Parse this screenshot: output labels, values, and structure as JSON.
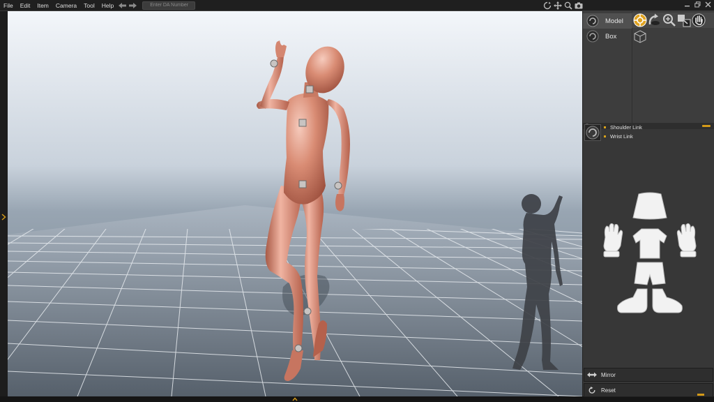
{
  "menu": {
    "items": [
      "File",
      "Edit",
      "Item",
      "Camera",
      "Tool",
      "Help"
    ],
    "da_placeholder": "Enter DA Number",
    "tool_icons": [
      "rotate-icon",
      "move-icon",
      "zoom-icon",
      "camera-icon"
    ],
    "window_controls": [
      "minimize-icon",
      "restore-icon",
      "close-icon"
    ]
  },
  "scene": {
    "items": [
      {
        "label": "Model",
        "selected": true
      },
      {
        "label": "Box",
        "selected": false
      }
    ],
    "tools": [
      "pose-tool-icon",
      "rotate-tool-icon",
      "zoom-tool-icon",
      "scale-tool-icon",
      "hand-tool-icon"
    ]
  },
  "links": {
    "items": [
      "Shoulder Link",
      "Wrist Link"
    ]
  },
  "body_parts": [
    "head",
    "left-hand",
    "torso",
    "right-hand",
    "hips",
    "feet"
  ],
  "buttons": {
    "mirror": "Mirror",
    "reset": "Reset"
  },
  "colors": {
    "accent": "#d49a18",
    "model_skin": "#d98c74",
    "grid": "#e8ecf0"
  }
}
